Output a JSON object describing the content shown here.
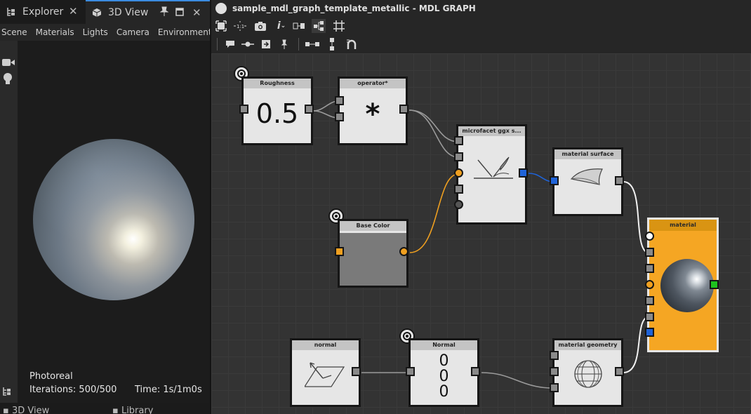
{
  "left_panel": {
    "tabs": [
      {
        "label": "Explorer",
        "icon": "tree-icon"
      },
      {
        "label": "3D View",
        "icon": "cube-icon"
      }
    ],
    "view_menu": [
      "Scene",
      "Materials",
      "Lights",
      "Camera",
      "Environment"
    ],
    "stats": {
      "mode": "Photoreal",
      "iterations": "Iterations: 500/500",
      "time": "Time: 1s/1m0s"
    },
    "bottom_tabs": [
      "3D View",
      "Library"
    ]
  },
  "graph": {
    "title": "sample_mdl_graph_template_metallic - MDL GRAPH",
    "nodes": {
      "roughness": {
        "title": "Roughness",
        "value": "0.5"
      },
      "operator": {
        "title": "operator*",
        "symbol": "*"
      },
      "microfacet": {
        "title": "microfacet ggx s..."
      },
      "material_surface": {
        "title": "material surface"
      },
      "base_color": {
        "title": "Base Color"
      },
      "material": {
        "title": "material"
      },
      "normal_func": {
        "title": "normal"
      },
      "normal_const": {
        "title": "Normal",
        "values": [
          "0",
          "0",
          "0"
        ]
      },
      "material_geometry": {
        "title": "material geometry"
      }
    }
  },
  "colors": {
    "accent_tab": "#3b8be0",
    "port_blue": "#1f63d8",
    "port_orange": "#f0a020",
    "port_green": "#1ec21e",
    "material_node": "#f5a623",
    "base_color_swatch": "#7a7a7a"
  }
}
